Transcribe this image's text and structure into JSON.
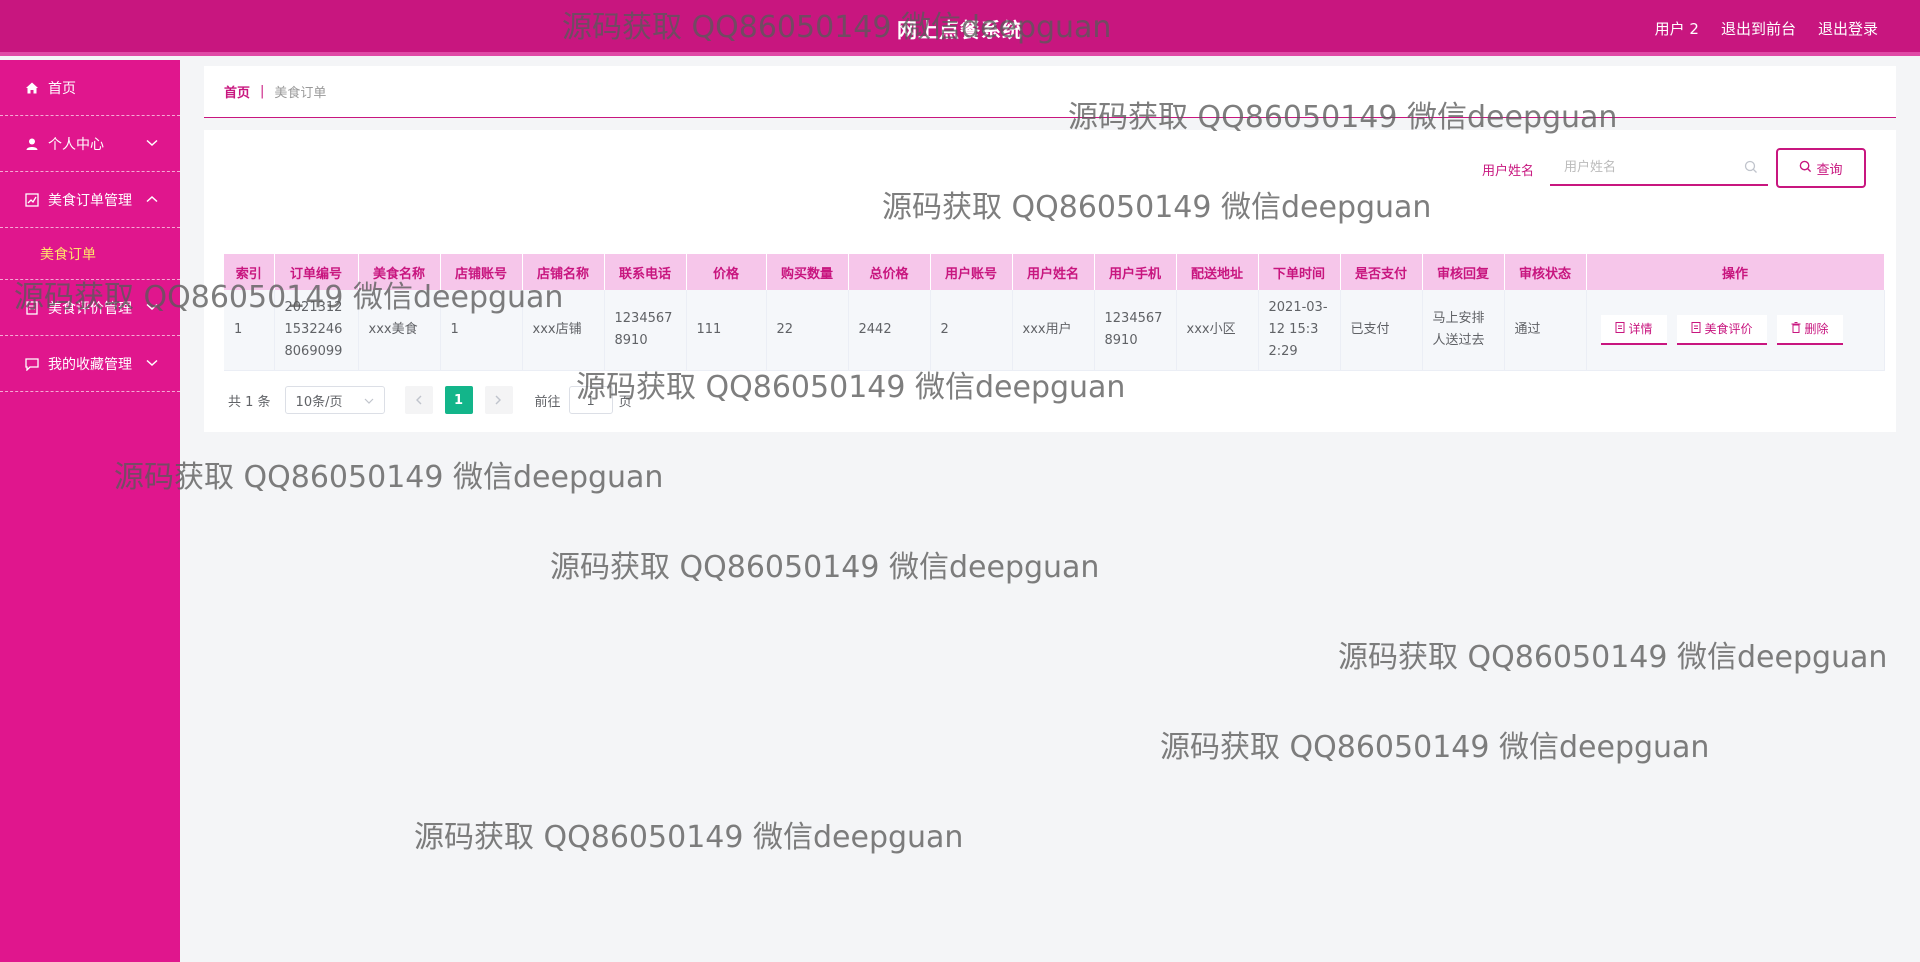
{
  "header": {
    "title": "网上点餐系统",
    "user_label": "用户 2",
    "front_label": "退出到前台",
    "logout_label": "退出登录"
  },
  "sidebar": {
    "items": [
      {
        "label": "首页",
        "icon": "home-icon"
      },
      {
        "label": "个人中心",
        "icon": "user-icon"
      },
      {
        "label": "美食订单管理",
        "icon": "chart-icon",
        "expanded": true,
        "children": [
          {
            "label": "美食订单"
          }
        ]
      },
      {
        "label": "美食评价管理",
        "icon": "doc-icon"
      },
      {
        "label": "我的收藏管理",
        "icon": "chat-icon"
      }
    ]
  },
  "breadcrumb": {
    "home": "首页",
    "separator": "|",
    "current": "美食订单"
  },
  "search": {
    "label": "用户姓名",
    "placeholder": "用户姓名",
    "button_label": "查询"
  },
  "table": {
    "headers": [
      "索引",
      "订单编号",
      "美食名称",
      "店铺账号",
      "店铺名称",
      "联系电话",
      "价格",
      "购买数量",
      "总价格",
      "用户账号",
      "用户姓名",
      "用户手机",
      "配送地址",
      "下单时间",
      "是否支付",
      "审核回复",
      "审核状态",
      "操作"
    ],
    "rows": [
      [
        "1",
        "20213121532246 8069099",
        "xxx美食",
        "1",
        "xxx店铺",
        "12345678910",
        "111",
        "22",
        "2442",
        "2",
        "xxx用户",
        "12345678910",
        "xxx小区",
        "2021-03-12 15:32:29",
        "已支付",
        "马上安排人送过去",
        "通过"
      ]
    ],
    "actions": [
      "详情",
      "美食评价",
      "删除"
    ]
  },
  "pagination": {
    "total": "共 1 条",
    "page_size": "10条/页",
    "current_page": "1",
    "goto_label": "前往",
    "goto_value": "1",
    "goto_suffix": "页"
  },
  "watermark": "源码获取 QQ86050149 微信deepguan",
  "colors": {
    "primary": "#c8167f",
    "sidebar": "#e0168d",
    "table_header": "#f6c6ea",
    "active_page": "#13b58a",
    "sub_item": "#ffe46a"
  }
}
